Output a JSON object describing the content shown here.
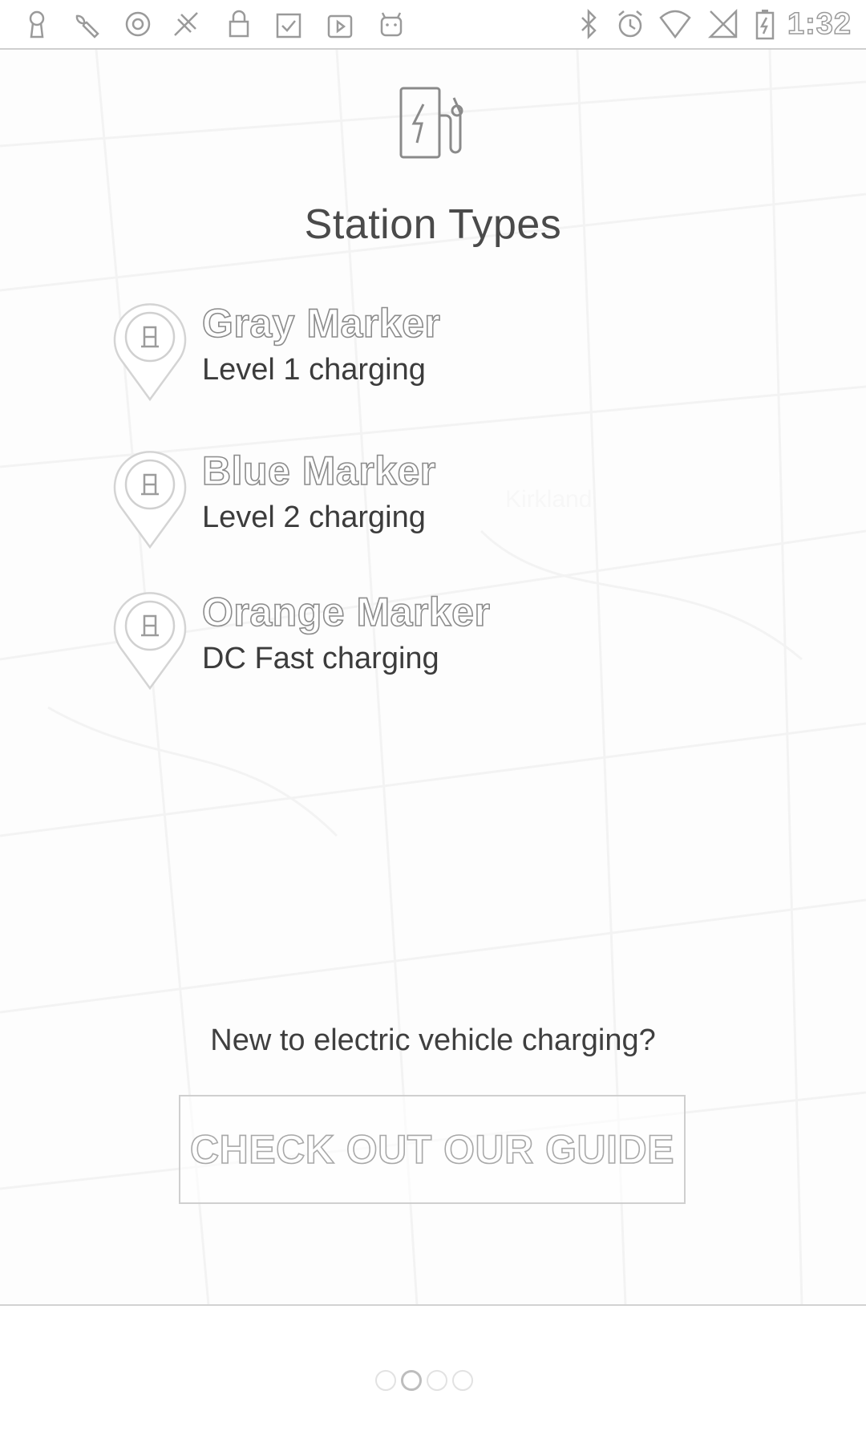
{
  "status_bar": {
    "time": "1:32",
    "left_icons": [
      "keyhole-icon",
      "wrench-icon",
      "circle-icon",
      "satellite-icon",
      "lock-icon",
      "clipboard-icon",
      "media-icon",
      "android-icon"
    ],
    "right_icons": [
      "bluetooth-icon",
      "alarm-icon",
      "wifi-icon",
      "no-signal-icon",
      "battery-charging-icon"
    ]
  },
  "page": {
    "icon": "ev-station-icon",
    "title": "Station Types"
  },
  "legend": [
    {
      "name": "Gray Marker",
      "description": "Level 1 charging",
      "icon": "station-pin-icon"
    },
    {
      "name": "Blue Marker",
      "description": "Level 2 charging",
      "icon": "station-pin-icon"
    },
    {
      "name": "Orange Marker",
      "description": "DC Fast charging",
      "icon": "station-pin-icon"
    }
  ],
  "guide": {
    "prompt": "New to electric vehicle charging?",
    "button_label": "CHECK OUT OUR GUIDE"
  },
  "pager": {
    "current_page": 2,
    "total_pages": 4
  },
  "map_labels": [
    "Kirkland"
  ]
}
